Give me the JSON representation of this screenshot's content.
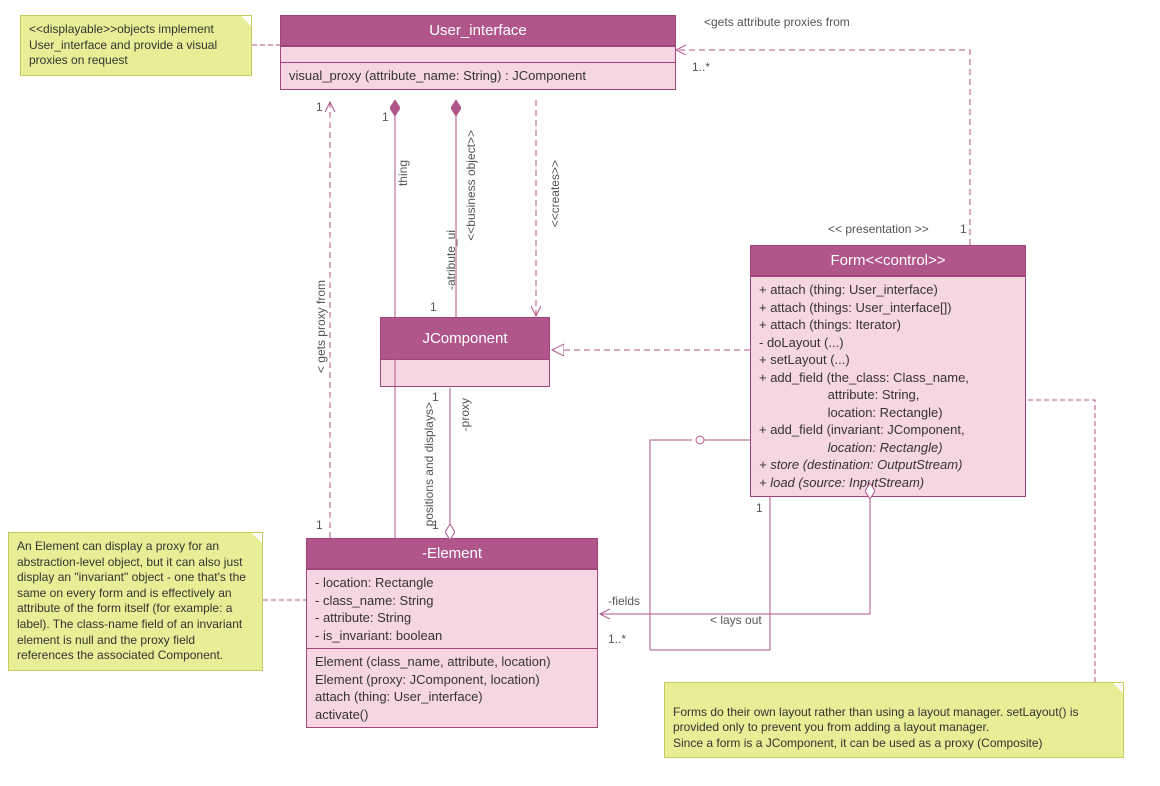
{
  "notes": {
    "displayable": "<<displayable>>objects implement User_interface and provide a visual proxies on request",
    "element": "An Element can display a proxy for an abstraction-level object, but it can also just display an \"invariant\" object - one that's the same on every form and is effectively an attribute of the form itself (for example: a label). The class-name field of an invariant element is null and the proxy field references the associated Component.",
    "form": "Forms do their own layout rather than using a layout manager. setLayout() is provided only to prevent you from adding a layout manager.\nSince a form is a JComponent, it can be used as a proxy (Composite)"
  },
  "classes": {
    "user_interface": {
      "name": "User_interface",
      "op": "visual_proxy (attribute_name: String) : JComponent"
    },
    "jcomponent": {
      "name": "JComponent"
    },
    "form": {
      "name": "Form<<control>>",
      "ops": [
        "+ attach (thing: User_interface)",
        "+ attach (things: User_interface[])",
        "+ attach (things: Iterator)",
        "- doLayout (...)",
        "+ setLayout (...)",
        "+ add_field (the_class: Class_name,",
        "                   attribute: String,",
        "                   location: Rectangle)",
        "+ add_field (invariant: JComponent,",
        "                   location: Rectangle)",
        "+ store (destination: OutputStream)",
        "+ load (source: InputStream)"
      ]
    },
    "element": {
      "name": "-Element",
      "attrs": [
        "- location: Rectangle",
        "- class_name: String",
        "- attribute: String",
        "- is_invariant: boolean"
      ],
      "ops": [
        "Element (class_name, attribute, location)",
        "Element (proxy: JComponent, location)",
        "attach (thing: User_interface)",
        "activate()"
      ]
    }
  },
  "labels": {
    "gets_attr_proxies": "<gets attribute proxies from",
    "presentation": "<< presentation >>",
    "thing": "thing",
    "business_object": "<<business object>>",
    "atribute_ui": "-atribute_ui",
    "creates": "<<creates>>",
    "gets_proxy_from": "< gets proxy from",
    "positions_displays": "positions and displays>",
    "proxy": "-proxy",
    "fields": "-fields",
    "lays_out": "< lays out",
    "one": "1",
    "one_star": "1..*",
    "one_star2": "1..*"
  }
}
